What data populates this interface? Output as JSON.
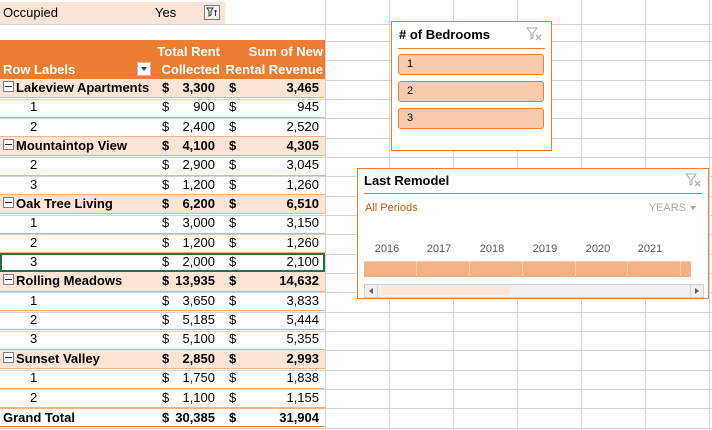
{
  "filter": {
    "label": "Occupied",
    "value": "Yes"
  },
  "pivot": {
    "headers": {
      "row_labels": "Row Labels",
      "col1_line1": "Total Rent",
      "col1_line2": "Collected",
      "col2_line1": "Sum of New",
      "col2_line2": "Rental Revenue"
    },
    "currency": "$",
    "rows": [
      {
        "type": "group",
        "label": "Lakeview Apartments",
        "rent": "3,300",
        "revenue": "3,465"
      },
      {
        "type": "child",
        "label": "1",
        "rent": "900",
        "revenue": "945"
      },
      {
        "type": "child",
        "label": "2",
        "rent": "2,400",
        "revenue": "2,520"
      },
      {
        "type": "group",
        "label": "Mountaintop View",
        "rent": "4,100",
        "revenue": "4,305"
      },
      {
        "type": "child",
        "label": "2",
        "rent": "2,900",
        "revenue": "3,045"
      },
      {
        "type": "child",
        "label": "3",
        "rent": "1,200",
        "revenue": "1,260"
      },
      {
        "type": "group",
        "label": "Oak Tree Living",
        "rent": "6,200",
        "revenue": "6,510"
      },
      {
        "type": "child",
        "label": "1",
        "rent": "3,000",
        "revenue": "3,150"
      },
      {
        "type": "child",
        "label": "2",
        "rent": "1,200",
        "revenue": "1,260"
      },
      {
        "type": "child",
        "label": "3",
        "rent": "2,000",
        "revenue": "2,100"
      },
      {
        "type": "group",
        "label": "Rolling Meadows",
        "rent": "13,935",
        "revenue": "14,632"
      },
      {
        "type": "child",
        "label": "1",
        "rent": "3,650",
        "revenue": "3,833"
      },
      {
        "type": "child",
        "label": "2",
        "rent": "5,185",
        "revenue": "5,444"
      },
      {
        "type": "child",
        "label": "3",
        "rent": "5,100",
        "revenue": "5,355"
      },
      {
        "type": "group",
        "label": "Sunset Valley",
        "rent": "2,850",
        "revenue": "2,993"
      },
      {
        "type": "child",
        "label": "1",
        "rent": "1,750",
        "revenue": "1,838"
      },
      {
        "type": "child",
        "label": "2",
        "rent": "1,100",
        "revenue": "1,155"
      },
      {
        "type": "total",
        "label": "Grand Total",
        "rent": "30,385",
        "revenue": "31,904"
      }
    ]
  },
  "bedrooms_slicer": {
    "title": "# of Bedrooms",
    "items": [
      "1",
      "2",
      "3"
    ]
  },
  "timeline": {
    "title": "Last Remodel",
    "period": "All Periods",
    "level": "YEARS",
    "years": [
      "2016",
      "2017",
      "2018",
      "2019",
      "2020",
      "2021"
    ]
  },
  "colors": {
    "accent": "#ed7d31",
    "light": "#fce4d6",
    "slicer_item": "#f8cbad"
  }
}
